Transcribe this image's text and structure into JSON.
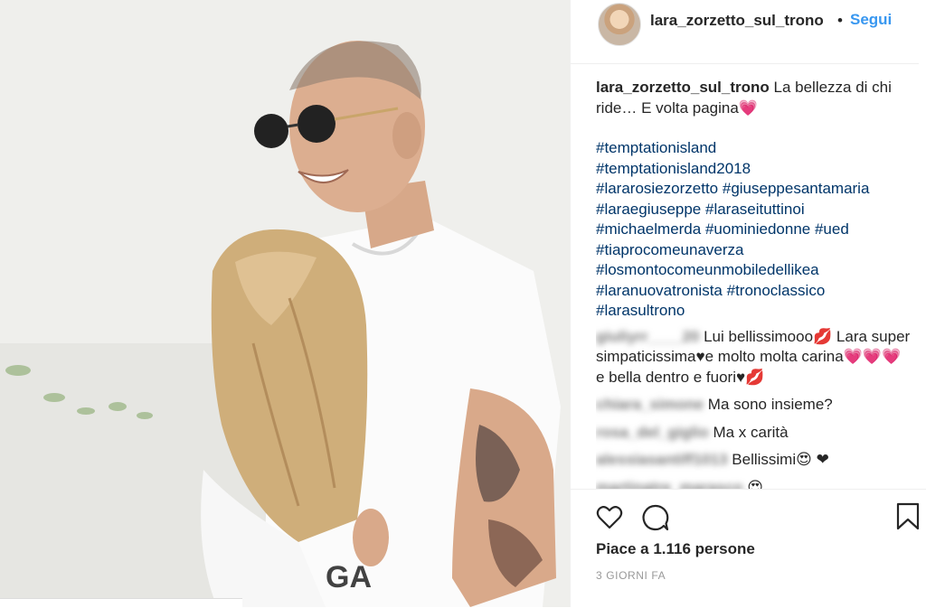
{
  "post": {
    "username": "lara_zorzetto_sul_trono",
    "separator": "•",
    "follow_label": "Segui"
  },
  "caption": {
    "username": "lara_zorzetto_sul_trono",
    "text": "La bellezza di chi ride… E volta pagina💗",
    "hashtags": [
      "#temptationisland",
      "#temptationisland2018",
      "#lararosiezorzetto",
      "#giuseppesantamaria",
      "#laraegiuseppe",
      "#laraseituttinoi",
      "#michaelmerda",
      "#uominiedonne",
      "#ued",
      "#tiaprocomeunaverza",
      "#losmontocomeunmobiledellikea",
      "#laranuovatronista",
      "#tronoclassico",
      "#larasultrono"
    ]
  },
  "comments": [
    {
      "user": "giuliyrr____20",
      "text": "Lui bellissimooo💋 Lara super simpaticissima♥e molto molta carina💗💗💗 e bella dentro e fuori♥💋"
    },
    {
      "user": "chiara_simone",
      "text": "Ma sono insieme?"
    },
    {
      "user": "rosa_del_giglio",
      "text": "Ma x carità"
    },
    {
      "user": "alessiasantiff1013",
      "text": "Bellissimi😍 ❤"
    },
    {
      "user": "martinatre_marasco",
      "text": "😍"
    }
  ],
  "actions": {
    "like_icon": "heart-outline-icon",
    "comment_icon": "speech-bubble-icon",
    "save_icon": "bookmark-icon",
    "likes_text": "Piace a 1.116 persone",
    "time_ago": "3 GIORNI FA"
  },
  "colors": {
    "link": "#3897f0",
    "hashtag": "#003569",
    "text": "#262626",
    "muted": "#999999"
  }
}
